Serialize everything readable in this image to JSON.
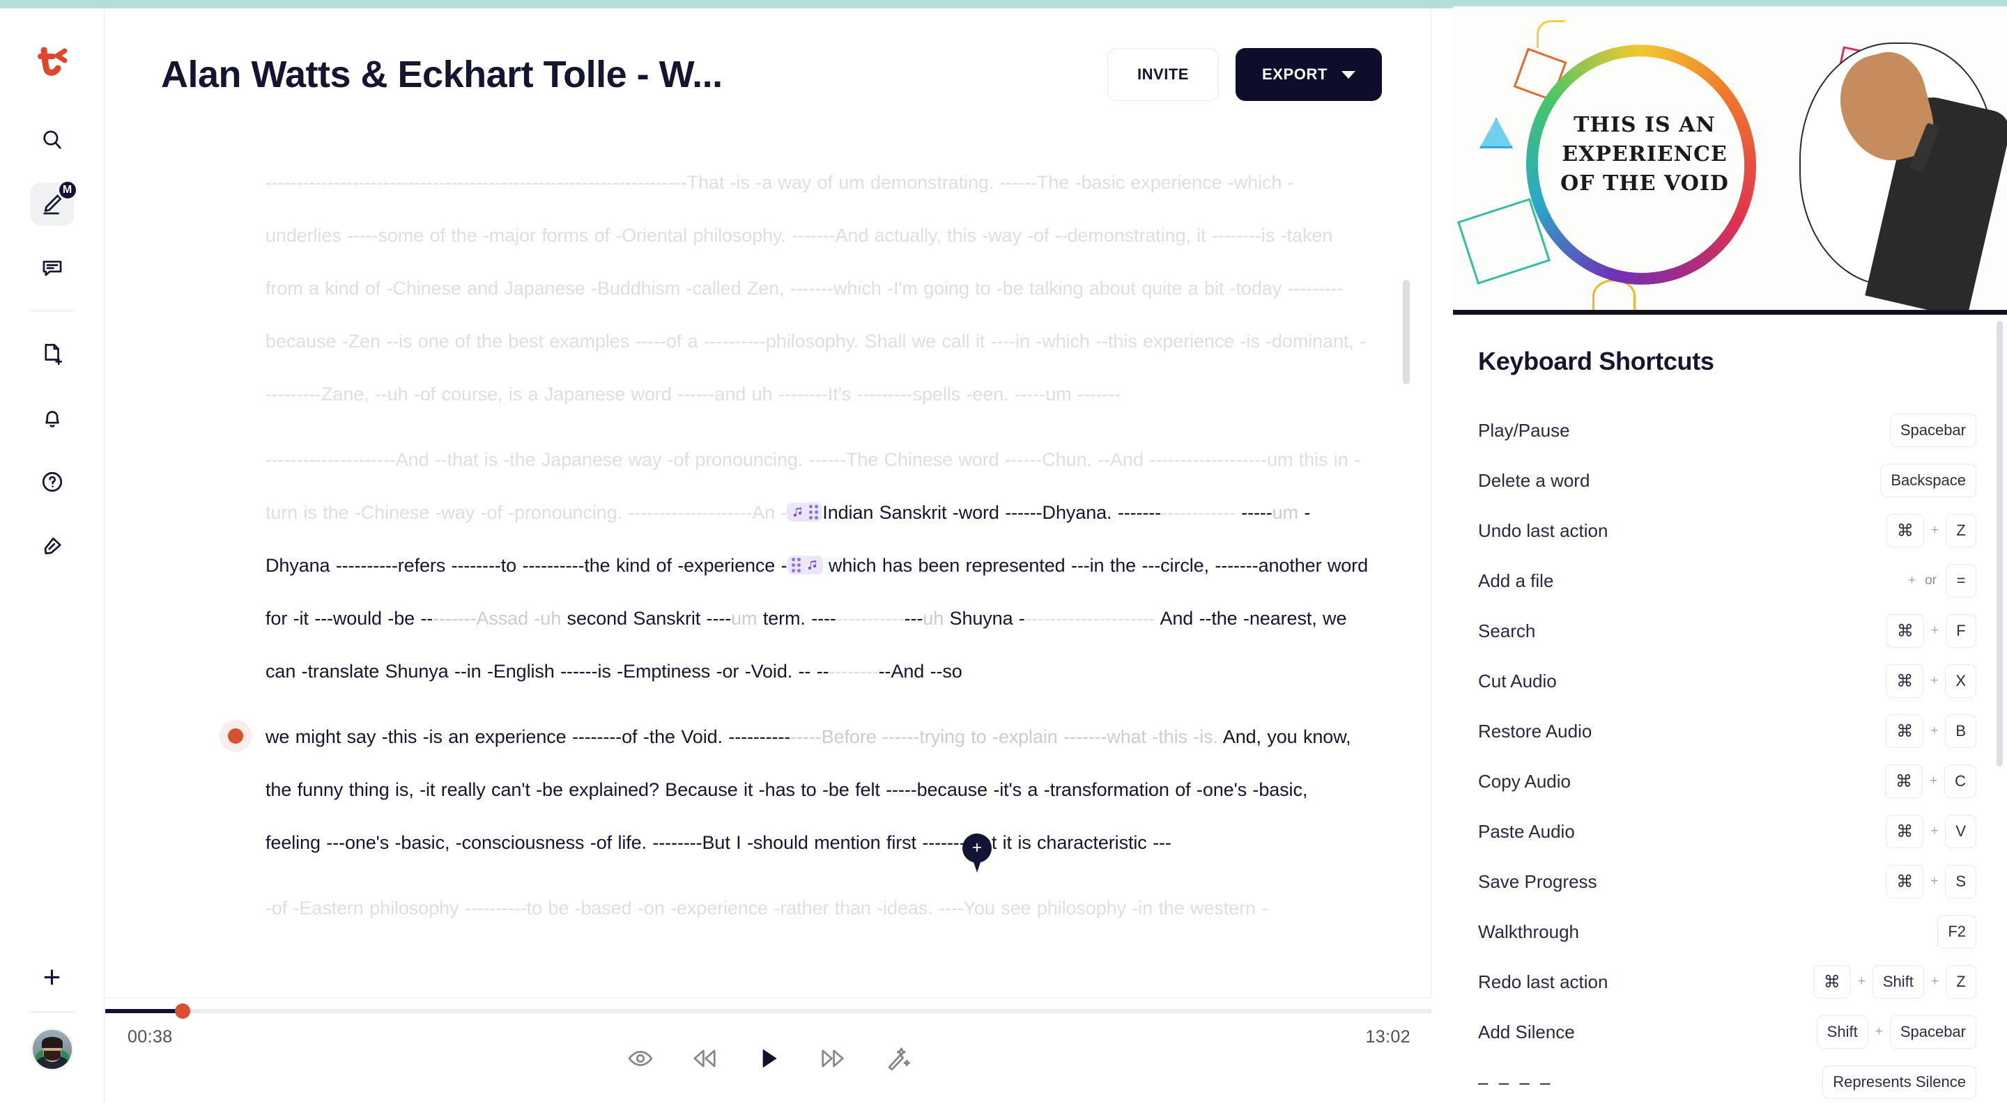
{
  "app": {
    "logo_icon": "descript-logo-icon",
    "accent_top_color": "#b7dcdc"
  },
  "sidebar": {
    "items": [
      {
        "name": "search",
        "icon": "search-icon",
        "badge": null,
        "active": false
      },
      {
        "name": "edit",
        "icon": "pencil-underline-icon",
        "badge": "M",
        "active": true
      },
      {
        "name": "comments",
        "icon": "comment-icon",
        "badge": null,
        "active": false
      },
      {
        "name": "new-document",
        "icon": "file-plus-icon",
        "badge": null,
        "active": false
      },
      {
        "name": "notifications",
        "icon": "bell-icon",
        "badge": null,
        "active": false
      },
      {
        "name": "help",
        "icon": "question-circle-icon",
        "badge": null,
        "active": false
      },
      {
        "name": "highlighter",
        "icon": "highlighter-icon",
        "badge": null,
        "active": false
      }
    ],
    "add_label": "+",
    "avatar_name": "user-avatar"
  },
  "header": {
    "title": "Alan Watts & Eckhart Tolle - W...",
    "invite_label": "INVITE",
    "export_label": "EXPORT",
    "export_chevron_icon": "chevron-down-icon"
  },
  "transcript": {
    "paragraphs": [
      {
        "active": false,
        "runs": [
          {
            "text": "--------------------------------------------------------------------That -is -a way of um demonstrating. ------The -basic experience -which -underlies -----some of the -major forms of -Oriental philosophy. -------And actually, this -way -of --demonstrating, it --------is -taken from a kind of -Chinese and Japanese -Buddhism -called Zen, -------which -I'm going to -be talking about quite a bit -today ---------because -Zen --is one of the best examples -----of a ----------philosophy. Shall we call it ----in -which --this experience -is -dominant, ----------Zane, --uh -of course, is a Japanese word ------and uh --------It's ---------spells -een. -----um -------",
            "tone": "dim"
          }
        ]
      },
      {
        "active": false,
        "runs": [
          {
            "text": "---------------------And --that is -the Japanese way -of pronouncing. ------The Chinese word ------Chun. --And -------------------um this in -turn is the -Chinese -way -of -pronouncing. --------------------An -",
            "tone": "dim"
          },
          {
            "chip": "music-note-left"
          },
          {
            "text": "Indian Sanskrit -word ------Dhyana. -",
            "tone": "dark"
          },
          {
            "text": "------",
            "tone": "dark"
          },
          {
            "text": "------------",
            "tone": "dim"
          },
          {
            "text": " -----",
            "tone": "dark"
          },
          {
            "text": "um",
            "tone": "mid"
          },
          {
            "text": " -Dhyana ----------refers --------to ----------the kind of -experience -",
            "tone": "dark"
          },
          {
            "chip": "music-note-right"
          },
          {
            "text": " which has been represented ---in the ---circle, -------another word for -it ---would -be --",
            "tone": "dark"
          },
          {
            "text": "-------Assad -uh",
            "tone": "mid"
          },
          {
            "text": " second Sanskrit ----",
            "tone": "dark"
          },
          {
            "text": "um",
            "tone": "mid"
          },
          {
            "text": " term. ----",
            "tone": "dark"
          },
          {
            "text": "-----------",
            "tone": "dim"
          },
          {
            "text": "---",
            "tone": "dark"
          },
          {
            "text": "uh",
            "tone": "mid"
          },
          {
            "text": " Shuyna -",
            "tone": "dark"
          },
          {
            "text": "---------------------",
            "tone": "dim"
          },
          {
            "text": " And --the -nearest, we can -translate Shunya --in -English ------is -Emptiness -or -Void. -- --",
            "tone": "dark"
          },
          {
            "text": "--------",
            "tone": "dim"
          },
          {
            "text": "--And --so",
            "tone": "dark"
          }
        ]
      },
      {
        "active": true,
        "runs": [
          {
            "text": "we might say -this -is an experience --------of -the Void. ----------",
            "tone": "dark"
          },
          {
            "text": "-----Before ------trying to -explain -------what -this -is.",
            "tone": "mid"
          },
          {
            "text": " And, you know, the funny thing is, -it really can't -be explained? Because it -has to -be felt -----because -it's a -transformation of -one's -basic, feeling ---one's -basic, -consciousness -of life. --------But I -should mention first -------that it is characteristic ---",
            "tone": "dark"
          }
        ]
      },
      {
        "active": false,
        "runs": [
          {
            "text": "-of -Eastern philosophy ----------to be -based -on -experience -rather than -ideas. ----You see philosophy -in the western -",
            "tone": "dim"
          }
        ]
      }
    ],
    "pin_icon": "add-marker-pin-icon",
    "pin_label": "+"
  },
  "player": {
    "current_time": "00:38",
    "total_time": "13:02",
    "progress_percent": 5,
    "playhead_color": "#d9502e",
    "controls": [
      {
        "name": "preview",
        "icon": "eye-icon"
      },
      {
        "name": "rewind",
        "icon": "rewind-icon"
      },
      {
        "name": "play",
        "icon": "play-icon"
      },
      {
        "name": "forward",
        "icon": "fast-forward-icon"
      },
      {
        "name": "ai-magic",
        "icon": "magic-wand-icon"
      }
    ]
  },
  "right_panel": {
    "video": {
      "name": "video-preview",
      "whiteboard_text_line1": "THIS IS AN",
      "whiteboard_text_line2": "EXPERIENCE",
      "whiteboard_text_line3": "OF THE VOID"
    },
    "shortcuts_title": "Keyboard Shortcuts",
    "shortcuts": [
      {
        "label": "Play/Pause",
        "keys": [
          "Spacebar"
        ]
      },
      {
        "label": "Delete a word",
        "keys": [
          "Backspace"
        ]
      },
      {
        "label": "Undo last action",
        "keys": [
          "⌘",
          "+",
          "Z"
        ]
      },
      {
        "label": "Add a file",
        "keys": [
          "+",
          "or",
          "="
        ]
      },
      {
        "label": "Search",
        "keys": [
          "⌘",
          "+",
          "F"
        ]
      },
      {
        "label": "Cut Audio",
        "keys": [
          "⌘",
          "+",
          "X"
        ]
      },
      {
        "label": "Restore Audio",
        "keys": [
          "⌘",
          "+",
          "B"
        ]
      },
      {
        "label": "Copy Audio",
        "keys": [
          "⌘",
          "+",
          "C"
        ]
      },
      {
        "label": "Paste Audio",
        "keys": [
          "⌘",
          "+",
          "V"
        ]
      },
      {
        "label": "Save Progress",
        "keys": [
          "⌘",
          "+",
          "S"
        ]
      },
      {
        "label": "Walkthrough",
        "keys": [
          "F2"
        ]
      },
      {
        "label": "Redo last action",
        "keys": [
          "⌘",
          "+",
          "Shift",
          "+",
          "Z"
        ]
      },
      {
        "label": "Add Silence",
        "keys": [
          "Shift",
          "+",
          "Spacebar"
        ]
      },
      {
        "label": "– – – –",
        "keys": [
          "Represents Silence"
        ]
      }
    ]
  }
}
